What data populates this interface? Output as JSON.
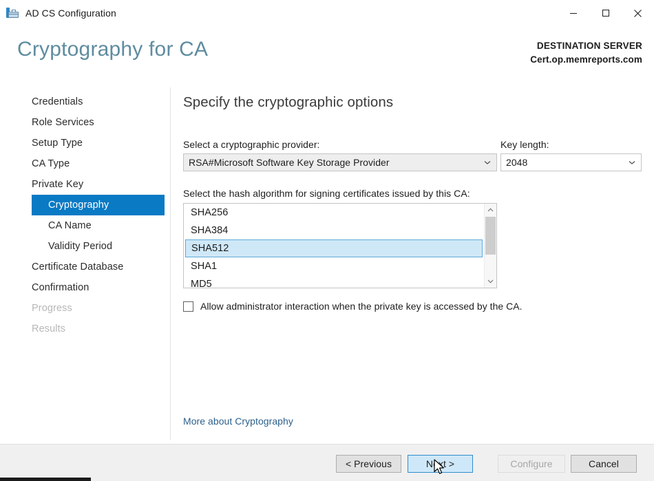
{
  "window": {
    "title": "AD CS Configuration",
    "app_icon": "toolbox-icon",
    "controls": {
      "minimize": "minimize-icon",
      "maximize": "maximize-icon",
      "close": "close-icon"
    }
  },
  "header": {
    "page_heading": "Cryptography for CA",
    "destination_label": "DESTINATION SERVER",
    "destination_server": "Cert.op.memreports.com"
  },
  "sidebar": {
    "items": [
      {
        "label": "Credentials",
        "indent": false,
        "state": "enabled"
      },
      {
        "label": "Role Services",
        "indent": false,
        "state": "enabled"
      },
      {
        "label": "Setup Type",
        "indent": false,
        "state": "enabled"
      },
      {
        "label": "CA Type",
        "indent": false,
        "state": "enabled"
      },
      {
        "label": "Private Key",
        "indent": false,
        "state": "enabled"
      },
      {
        "label": "Cryptography",
        "indent": true,
        "state": "selected"
      },
      {
        "label": "CA Name",
        "indent": true,
        "state": "enabled"
      },
      {
        "label": "Validity Period",
        "indent": true,
        "state": "enabled"
      },
      {
        "label": "Certificate Database",
        "indent": false,
        "state": "enabled"
      },
      {
        "label": "Confirmation",
        "indent": false,
        "state": "enabled"
      },
      {
        "label": "Progress",
        "indent": false,
        "state": "disabled"
      },
      {
        "label": "Results",
        "indent": false,
        "state": "disabled"
      }
    ]
  },
  "main": {
    "title": "Specify the cryptographic options",
    "provider": {
      "label": "Select a cryptographic provider:",
      "value": "RSA#Microsoft Software Key Storage Provider",
      "chevron": "chevron-down-icon"
    },
    "key_length": {
      "label": "Key length:",
      "value": "2048",
      "chevron": "chevron-down-icon"
    },
    "hash": {
      "label": "Select the hash algorithm for signing certificates issued by this CA:",
      "options": [
        "SHA256",
        "SHA384",
        "SHA512",
        "SHA1",
        "MD5"
      ],
      "selected": "SHA512",
      "scroll_up_icon": "chevron-up-icon",
      "scroll_down_icon": "chevron-down-icon"
    },
    "allow_admin_interaction": {
      "label": "Allow administrator interaction when the private key is accessed by the CA.",
      "checked": false
    },
    "help_link": "More about Cryptography"
  },
  "footer": {
    "previous": "< Previous",
    "next": "Next >",
    "configure": "Configure",
    "cancel": "Cancel"
  },
  "colors": {
    "accent_blue": "#0a7ac4",
    "heading_teal": "#5f8ca0",
    "selection_fill": "#cfe8f7",
    "selection_border": "#5ba9d8",
    "link": "#2c5f8a"
  }
}
